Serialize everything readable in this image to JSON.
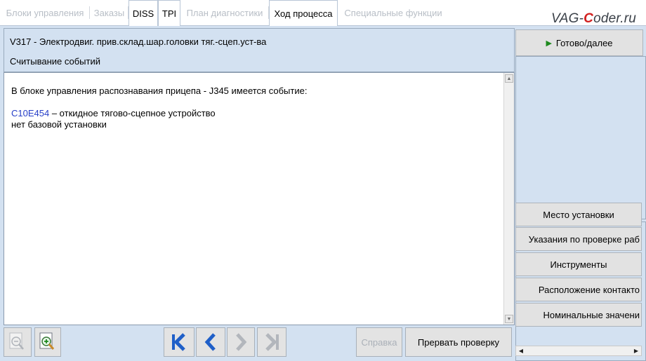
{
  "tabs": [
    {
      "label": "Блоки управления",
      "active": false
    },
    {
      "label": "Заказы",
      "active": false
    },
    {
      "label": "DISS",
      "active": true
    },
    {
      "label": "TPI",
      "active": true
    },
    {
      "label": "План диагностики",
      "active": false
    },
    {
      "label": "Ход процесса",
      "active": true
    },
    {
      "label": "Специальные функции",
      "active": false
    }
  ],
  "logo": {
    "part1": "VAG-",
    "part2": "C",
    "part3": "oder.ru"
  },
  "header": {
    "title": "V317 - Электродвиг. прив.склад.шар.головки тяг.-сцеп.уст-ва",
    "subtitle": "Считывание событий"
  },
  "content": {
    "line1": "В блоке управления распознавания прицепа - J345 имеется событие:",
    "code": "C10E454",
    "line2_rest": " – откидное тягово-сцепное устройство",
    "line3": "нет базовой установки"
  },
  "right_panel": {
    "next_button": "Готово/далее",
    "buttons": [
      "Место установки",
      "Указания по проверке раб",
      "Инструменты",
      "Расположение контакто",
      "Номинальные значени"
    ]
  },
  "toolbar": {
    "help": "Справка",
    "abort": "Прервать проверку"
  },
  "colors": {
    "frame_blue": "#d3e1f1",
    "code_blue": "#2840c8",
    "nav_blue": "#1f5fc8",
    "play_green": "#1e8a1e",
    "logo_red": "#d2201f"
  }
}
